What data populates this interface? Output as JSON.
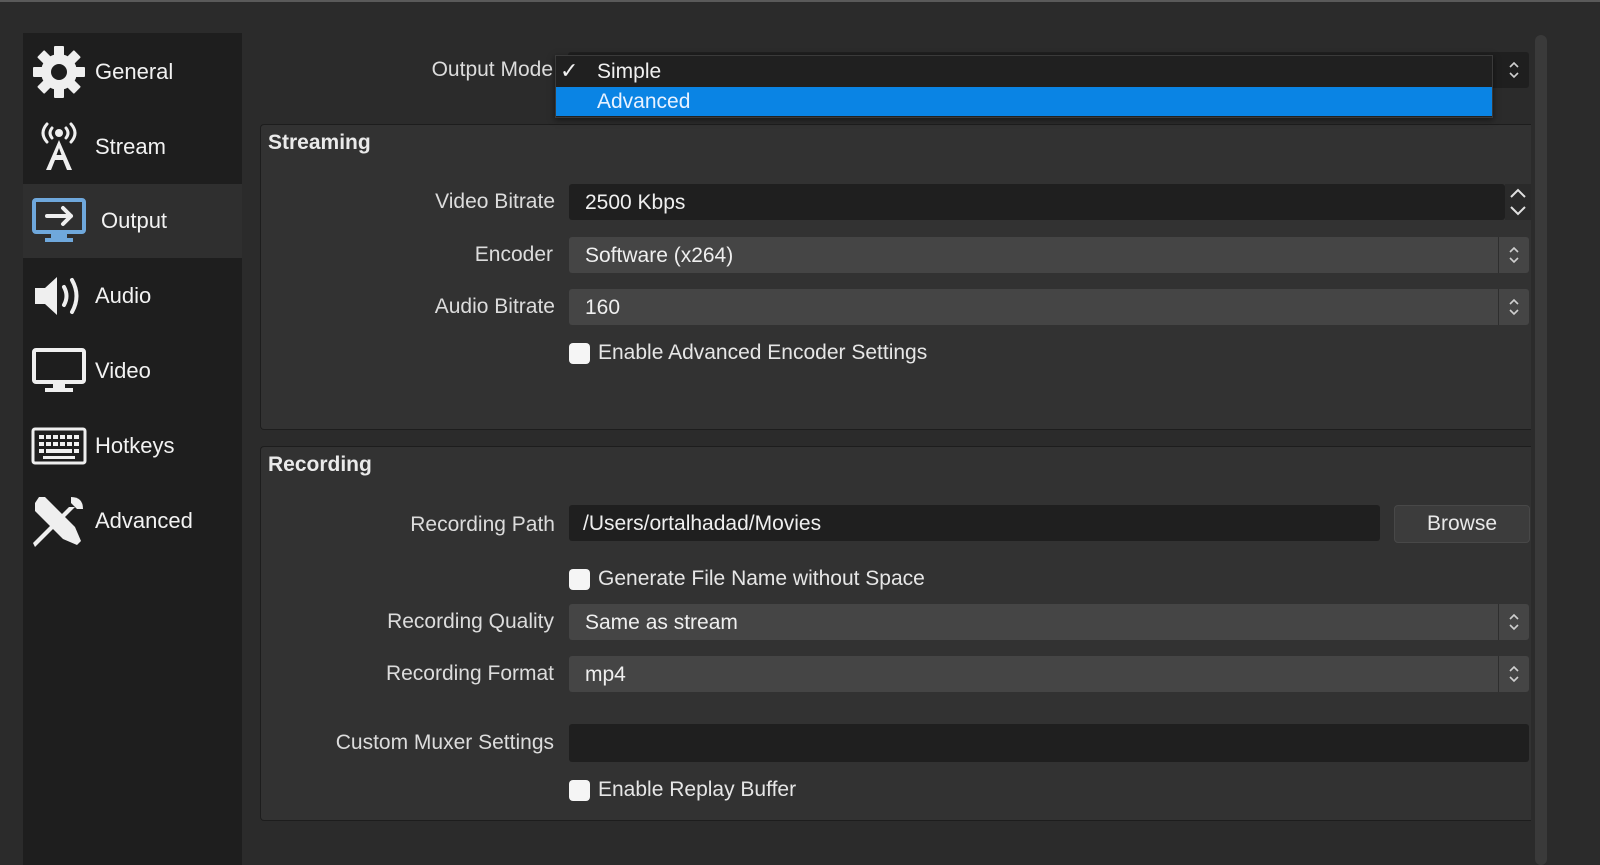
{
  "sidebar": {
    "items": [
      {
        "label": "General",
        "icon": "gear-icon"
      },
      {
        "label": "Stream",
        "icon": "antenna-icon"
      },
      {
        "label": "Output",
        "icon": "output-monitor-icon",
        "active": true
      },
      {
        "label": "Audio",
        "icon": "speaker-icon"
      },
      {
        "label": "Video",
        "icon": "monitor-icon"
      },
      {
        "label": "Hotkeys",
        "icon": "keyboard-icon"
      },
      {
        "label": "Advanced",
        "icon": "tools-icon"
      }
    ]
  },
  "output_mode": {
    "label": "Output Mode",
    "options": [
      {
        "label": "Simple",
        "checked": true
      },
      {
        "label": "Advanced",
        "highlighted": true
      }
    ]
  },
  "streaming": {
    "title": "Streaming",
    "video_bitrate_label": "Video Bitrate",
    "video_bitrate_value": "2500 Kbps",
    "encoder_label": "Encoder",
    "encoder_value": "Software (x264)",
    "audio_bitrate_label": "Audio Bitrate",
    "audio_bitrate_value": "160",
    "advanced_encoder_checkbox": "Enable Advanced Encoder Settings"
  },
  "recording": {
    "title": "Recording",
    "path_label": "Recording Path",
    "path_value": "/Users/ortalhadad/Movies",
    "browse_label": "Browse",
    "filename_checkbox": "Generate File Name without Space",
    "quality_label": "Recording Quality",
    "quality_value": "Same as stream",
    "format_label": "Recording Format",
    "format_value": "mp4",
    "muxer_label": "Custom Muxer Settings",
    "muxer_value": "",
    "replay_checkbox": "Enable Replay Buffer"
  },
  "colors": {
    "accent": "#0a84e4",
    "background": "#2b2b2b",
    "sidebar": "#1e1e1e"
  }
}
